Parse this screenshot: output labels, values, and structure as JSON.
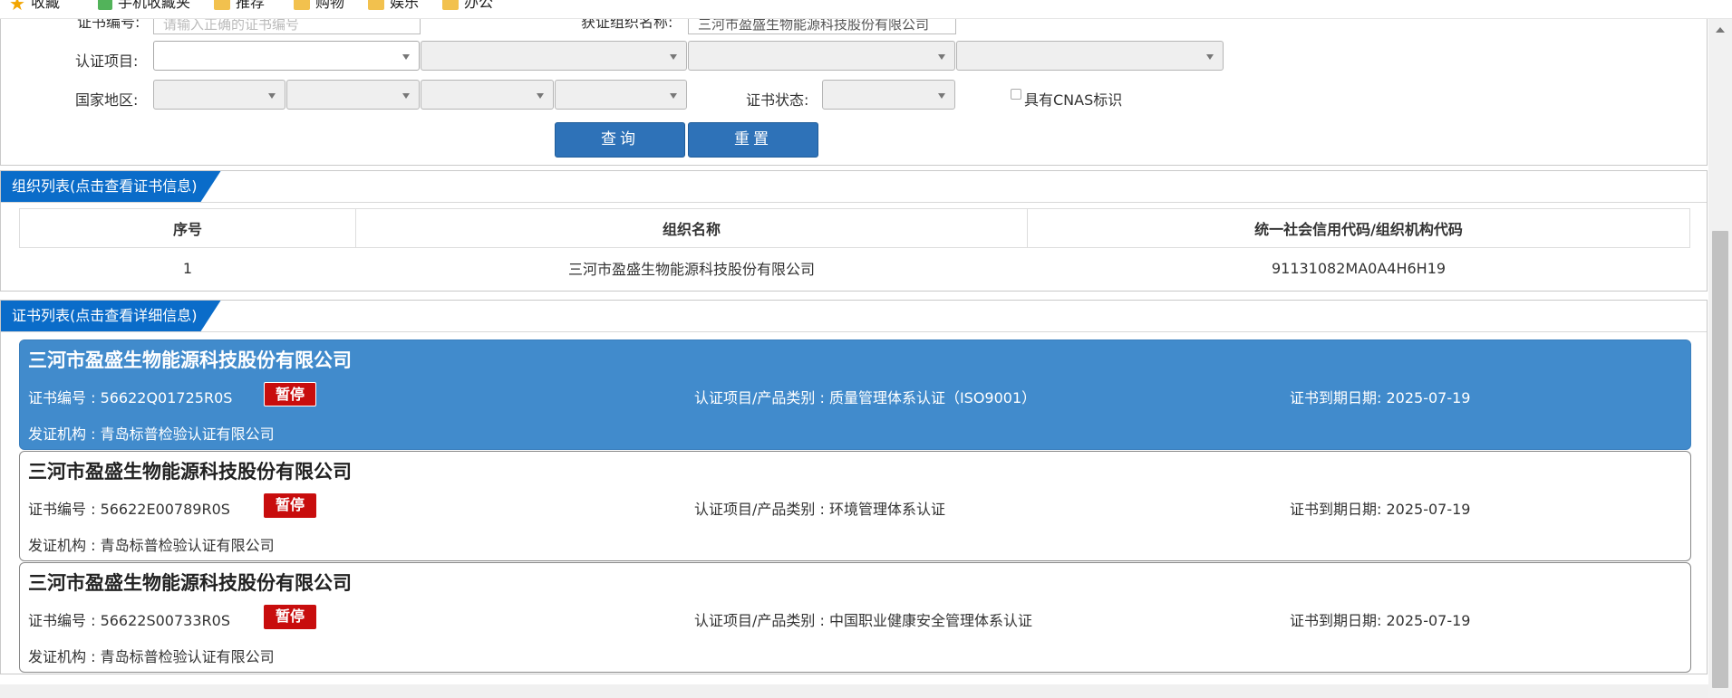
{
  "bookmarks": [
    {
      "icon": "star-icon",
      "label": "收藏"
    },
    {
      "icon": "mobile-bookmark-icon",
      "label": "手机收藏夹"
    },
    {
      "icon": "folder-icon",
      "label": "推荐"
    },
    {
      "icon": "folder-icon",
      "label": "购物"
    },
    {
      "icon": "folder-icon",
      "label": "娱乐"
    },
    {
      "icon": "folder-icon",
      "label": "办公"
    }
  ],
  "search": {
    "cert_no_label": "证书编号:",
    "cert_no_placeholder": "请输入正确的证书编号",
    "org_name_label": "获证组织名称:",
    "org_name_value": "三河市盈盛生物能源科技股份有限公司",
    "cert_project_label": "认证项目:",
    "region_label": "国家地区:",
    "cert_status_label": "证书状态:",
    "cnas_label": "具有CNAS标识",
    "query_button": "查询",
    "reset_button": "重置"
  },
  "org_section": {
    "title": "组织列表(点击查看证书信息)",
    "columns": [
      "序号",
      "组织名称",
      "统一社会信用代码/组织机构代码"
    ],
    "rows": [
      {
        "index": "1",
        "name": "三河市盈盛生物能源科技股份有限公司",
        "code": "91131082MA0A4H6H19"
      }
    ]
  },
  "cert_section": {
    "title": "证书列表(点击查看详细信息)",
    "cards": [
      {
        "org": "三河市盈盛生物能源科技股份有限公司",
        "cert_no": "证书编号 : 56622Q01725R0S",
        "status": "暂停",
        "project": "认证项目/产品类别 : 质量管理体系认证（ISO9001）",
        "expiry": "证书到期日期: 2025-07-19",
        "issuer": "发证机构 : 青岛标普检验认证有限公司"
      },
      {
        "org": "三河市盈盛生物能源科技股份有限公司",
        "cert_no": "证书编号 : 56622E00789R0S",
        "status": "暂停",
        "project": "认证项目/产品类别 : 环境管理体系认证",
        "expiry": "证书到期日期: 2025-07-19",
        "issuer": "发证机构 : 青岛标普检验认证有限公司"
      },
      {
        "org": "三河市盈盛生物能源科技股份有限公司",
        "cert_no": "证书编号 : 56622S00733R0S",
        "status": "暂停",
        "project": "认证项目/产品类别 : 中国职业健康安全管理体系认证",
        "expiry": "证书到期日期: 2025-07-19",
        "issuer": "发证机构 : 青岛标普检验认证有限公司"
      }
    ]
  },
  "colors": {
    "accent_blue": "#2e72b8",
    "tab_blue": "#0a6cc9",
    "active_card": "#418bcc",
    "badge_red": "#c80d0d"
  }
}
